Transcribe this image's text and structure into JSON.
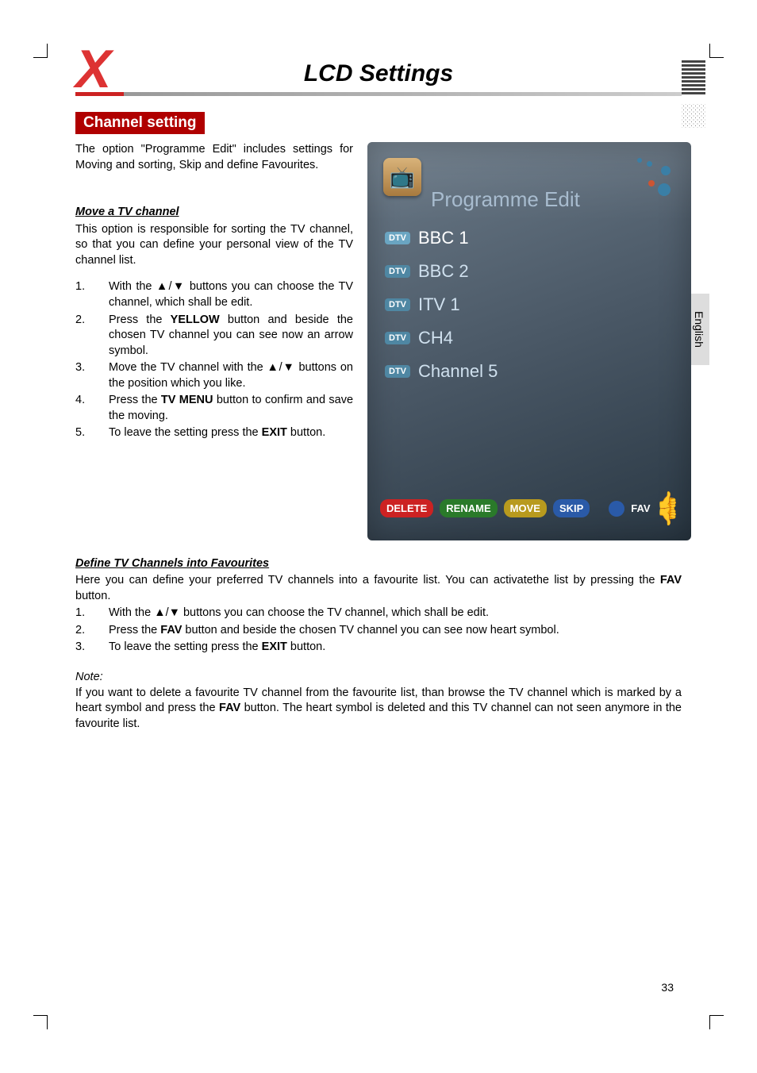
{
  "page_title": "LCD Settings",
  "section_bar": "Channel setting",
  "language_tab": "English",
  "page_number": "33",
  "intro": "The option \"Programme Edit\" includes settings for Moving and sorting, Skip and define Favourites.",
  "move": {
    "heading": "Move a TV channel",
    "desc": "This option is responsible for sorting the TV channel, so that you can define your personal view of the TV channel list.",
    "steps": [
      {
        "n": "1.",
        "pre": "With the ▲/▼ buttons you can choose the TV channel, which shall be edit."
      },
      {
        "n": "2.",
        "pre": "Press the ",
        "b": "YELLOW",
        "post": " button and beside the chosen TV channel you can see now an arrow symbol."
      },
      {
        "n": "3.",
        "pre": "Move the TV channel with the ▲/▼ buttons on the position which you like."
      },
      {
        "n": "4.",
        "pre": "Press the ",
        "b": "TV MENU",
        "post": " button to confirm and save the moving."
      },
      {
        "n": "5.",
        "pre": "To leave the setting press the ",
        "b": "EXIT",
        "post": " button."
      }
    ]
  },
  "fav": {
    "heading": "Define TV Channels into Favourites",
    "desc_pre": "Here you can define your preferred TV channels into a favourite list. You can activatethe list by pressing the ",
    "desc_b": "FAV",
    "desc_post": " button.",
    "steps": [
      {
        "n": "1.",
        "pre": "With the ▲/▼ buttons you can choose the TV channel, which shall be edit."
      },
      {
        "n": "2.",
        "pre": "Press the ",
        "b": "FAV",
        "post": " button and beside the chosen TV channel you can see now heart symbol."
      },
      {
        "n": "3.",
        "pre": "To leave the setting press the ",
        "b": "EXIT",
        "post": " button."
      }
    ]
  },
  "note": {
    "label": "Note:",
    "pre": "If you want to delete a favourite TV channel from the favourite list, than browse the TV channel which is marked by a heart symbol and press the ",
    "b": "FAV",
    "post": " button. The heart symbol is deleted and this TV channel can not seen anymore in the favourite list."
  },
  "osd": {
    "title": "Programme Edit",
    "channels": [
      {
        "tag": "DTV",
        "name": "BBC 1",
        "sel": true
      },
      {
        "tag": "DTV",
        "name": "BBC 2"
      },
      {
        "tag": "DTV",
        "name": "ITV 1"
      },
      {
        "tag": "DTV",
        "name": "CH4"
      },
      {
        "tag": "DTV",
        "name": "Channel 5"
      }
    ],
    "buttons": [
      {
        "label": "DELETE",
        "cls": "red"
      },
      {
        "label": "RENAME",
        "cls": "green"
      },
      {
        "label": "MOVE",
        "cls": "yellow"
      },
      {
        "label": "SKIP",
        "cls": "blue"
      }
    ],
    "fav_btn": "FAV"
  }
}
